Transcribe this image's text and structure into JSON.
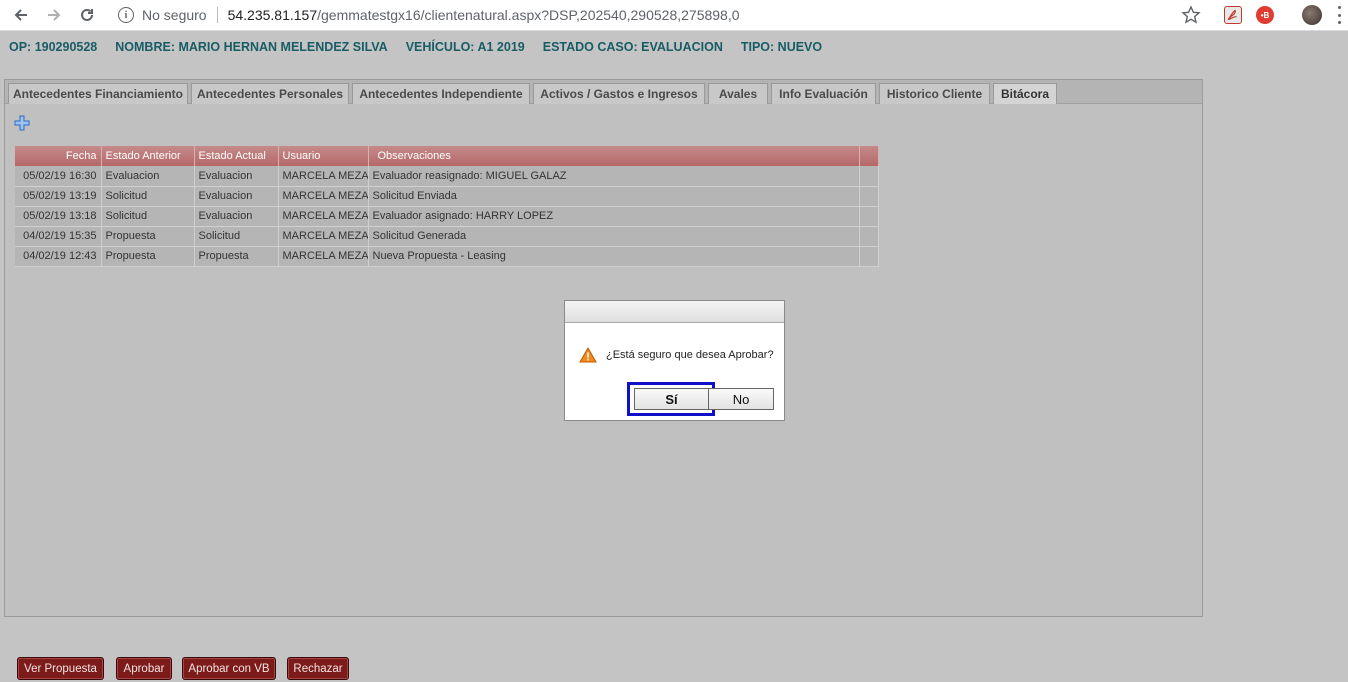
{
  "browser": {
    "security_label": "No seguro",
    "url_host": "54.235.81.157",
    "url_path": "/gemmatestgx16/clientenatural.aspx?DSP,202540,290528,275898,0",
    "extension_b_label": "•B",
    "icons": [
      "back-arrow-icon",
      "forward-arrow-icon",
      "reload-icon",
      "info-icon",
      "star-icon",
      "pdf-extension-icon",
      "b-extension-icon",
      "profile-avatar",
      "menu-dots-icon"
    ]
  },
  "header": {
    "op": "OP: 190290528",
    "nombre": "NOMBRE: MARIO HERNAN MELENDEZ SILVA",
    "vehiculo": "VEHÍCULO: A1 2019",
    "estado": "ESTADO CASO: EVALUACION",
    "tipo": "TIPO: NUEVO",
    "color": "#185c66"
  },
  "tabs": [
    {
      "label": "Antecedentes Financiamiento"
    },
    {
      "label": "Antecedentes Personales"
    },
    {
      "label": "Antecedentes Independiente"
    },
    {
      "label": "Activos / Gastos e Ingresos"
    },
    {
      "label": "Avales"
    },
    {
      "label": "Info Evaluación"
    },
    {
      "label": "Historico Cliente"
    },
    {
      "label": "Bitácora",
      "active": true
    }
  ],
  "grid": {
    "columns": [
      "Fecha",
      "Estado Anterior",
      "Estado Actual",
      "Usuario",
      "Observaciones"
    ],
    "rows": [
      [
        "05/02/19 16:30",
        "Evaluacion",
        "Evaluacion",
        "MARCELA MEZA",
        "Evaluador reasignado: MIGUEL GALAZ"
      ],
      [
        "05/02/19 13:19",
        "Solicitud",
        "Evaluacion",
        "MARCELA MEZA",
        "Solicitud Enviada"
      ],
      [
        "05/02/19 13:18",
        "Solicitud",
        "Evaluacion",
        "MARCELA MEZA",
        "Evaluador asignado: HARRY LOPEZ"
      ],
      [
        "04/02/19 15:35",
        "Propuesta",
        "Solicitud",
        "MARCELA MEZA",
        "Solicitud Generada"
      ],
      [
        "04/02/19 12:43",
        "Propuesta",
        "Propuesta",
        "MARCELA MEZA",
        "Nueva Propuesta - Leasing"
      ]
    ],
    "header_color": "#b56868"
  },
  "dialog": {
    "message": "¿Está seguro que desea Aprobar?",
    "yes_label": "Sí",
    "no_label": "No",
    "focus_color": "#1010c8"
  },
  "actions": {
    "ver_propuesta": "Ver Propuesta",
    "aprobar": "Aprobar",
    "aprobar_vb": "Aprobar con VB",
    "rechazar": "Rechazar",
    "color": "#7d1b1b"
  }
}
